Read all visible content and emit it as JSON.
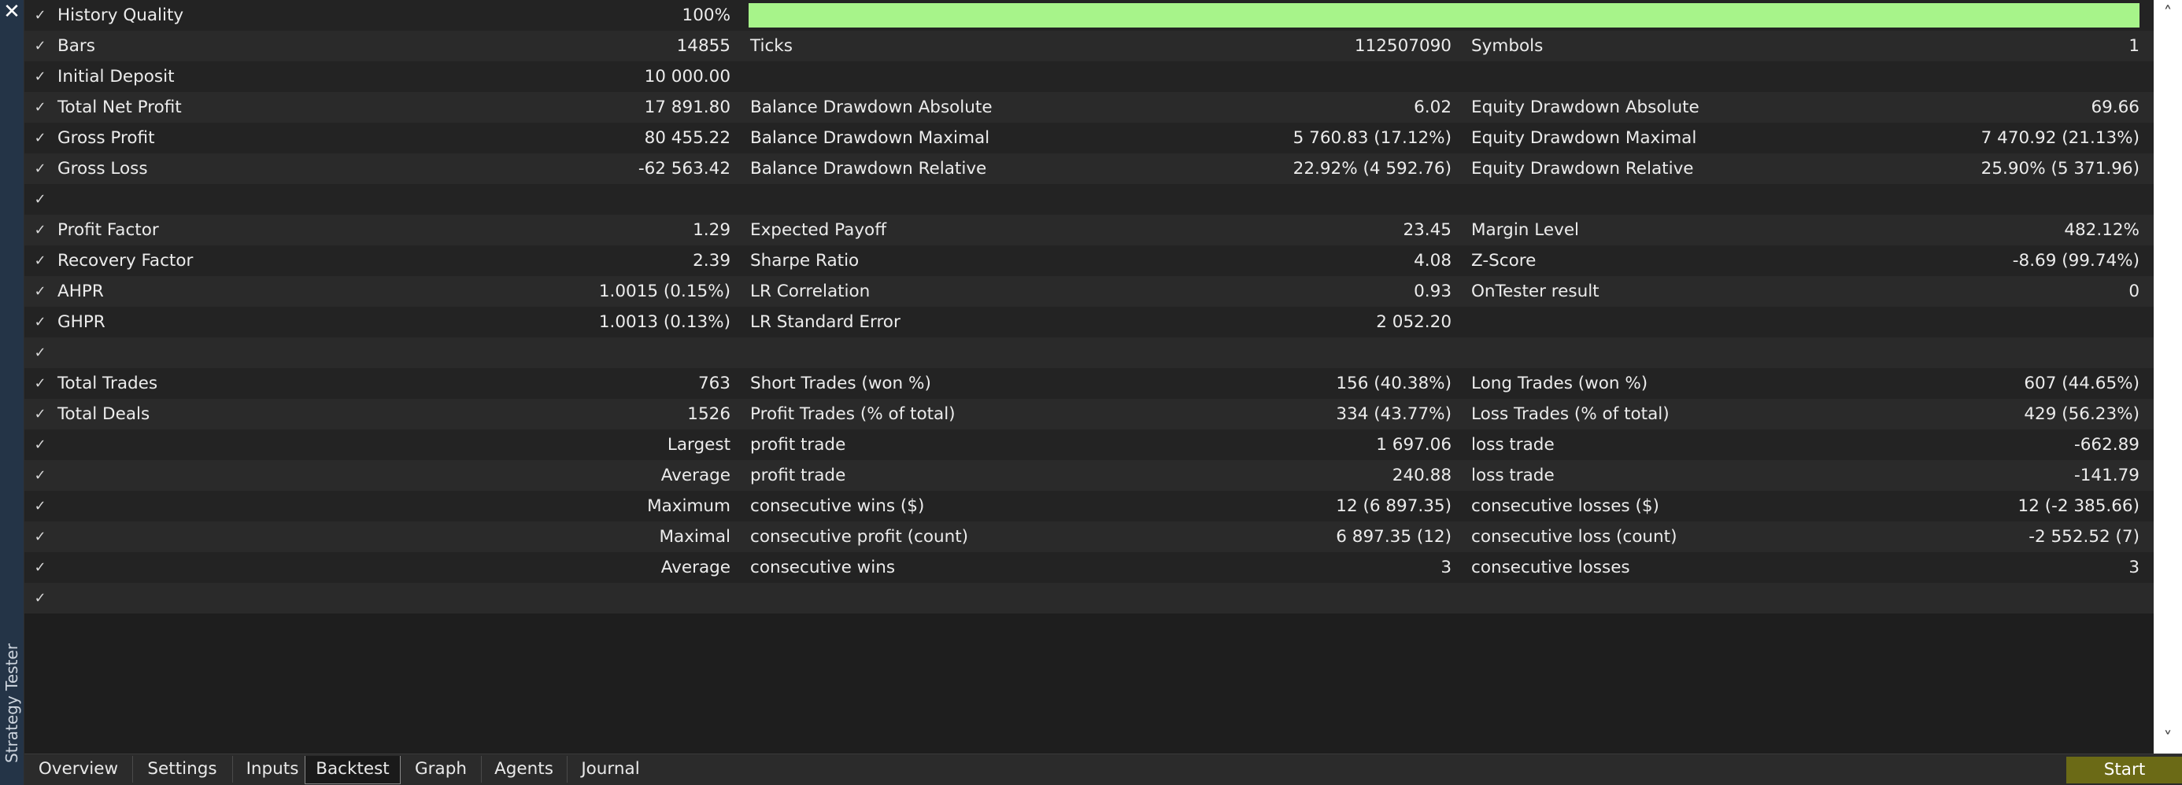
{
  "window": {
    "close_glyph": "✕",
    "title": "Strategy Tester"
  },
  "quality": {
    "label": "History Quality",
    "value": "100%",
    "fraction": 1.0,
    "bar_color": "#a7f48a"
  },
  "rows": [
    {
      "l1": "Bars",
      "v1": "14855",
      "l2": "Ticks",
      "v2": "112507090",
      "l3": "Symbols",
      "v3": "1"
    },
    {
      "l1": "Initial Deposit",
      "v1": "10 000.00",
      "l2": "",
      "v2": "",
      "l3": "",
      "v3": ""
    },
    {
      "l1": "Total Net Profit",
      "v1": "17 891.80",
      "l2": "Balance Drawdown Absolute",
      "v2": "6.02",
      "l3": "Equity Drawdown Absolute",
      "v3": "69.66"
    },
    {
      "l1": "Gross Profit",
      "v1": "80 455.22",
      "l2": "Balance Drawdown Maximal",
      "v2": "5 760.83 (17.12%)",
      "l3": "Equity Drawdown Maximal",
      "v3": "7 470.92 (21.13%)"
    },
    {
      "l1": "Gross Loss",
      "v1": "-62 563.42",
      "l2": "Balance Drawdown Relative",
      "v2": "22.92% (4 592.76)",
      "l3": "Equity Drawdown Relative",
      "v3": "25.90% (5 371.96)"
    },
    {
      "l1": "",
      "v1": "",
      "l2": "",
      "v2": "",
      "l3": "",
      "v3": ""
    },
    {
      "l1": "Profit Factor",
      "v1": "1.29",
      "l2": "Expected Payoff",
      "v2": "23.45",
      "l3": "Margin Level",
      "v3": "482.12%"
    },
    {
      "l1": "Recovery Factor",
      "v1": "2.39",
      "l2": "Sharpe Ratio",
      "v2": "4.08",
      "l3": "Z-Score",
      "v3": "-8.69 (99.74%)"
    },
    {
      "l1": "AHPR",
      "v1": "1.0015 (0.15%)",
      "l2": "LR Correlation",
      "v2": "0.93",
      "l3": "OnTester result",
      "v3": "0"
    },
    {
      "l1": "GHPR",
      "v1": "1.0013 (0.13%)",
      "l2": "LR Standard Error",
      "v2": "2 052.20",
      "l3": "",
      "v3": ""
    },
    {
      "l1": "",
      "v1": "",
      "l2": "",
      "v2": "",
      "l3": "",
      "v3": ""
    },
    {
      "l1": "Total Trades",
      "v1": "763",
      "l2": "Short Trades (won %)",
      "v2": "156 (40.38%)",
      "l3": "Long Trades (won %)",
      "v3": "607 (44.65%)"
    },
    {
      "l1": "Total Deals",
      "v1": "1526",
      "l2": "Profit Trades (% of total)",
      "v2": "334 (43.77%)",
      "l3": "Loss Trades (% of total)",
      "v3": "429 (56.23%)"
    }
  ],
  "right_rows": [
    {
      "l1": "Largest",
      "l2": "profit trade",
      "v2": "1 697.06",
      "l3": "loss trade",
      "v3": "-662.89"
    },
    {
      "l1": "Average",
      "l2": "profit trade",
      "v2": "240.88",
      "l3": "loss trade",
      "v3": "-141.79"
    },
    {
      "l1": "Maximum",
      "l2": "consecutive wins ($)",
      "v2": "12 (6 897.35)",
      "l3": "consecutive losses ($)",
      "v3": "12 (-2 385.66)"
    },
    {
      "l1": "Maximal",
      "l2": "consecutive profit (count)",
      "v2": "6 897.35 (12)",
      "l3": "consecutive loss (count)",
      "v3": "-2 552.52 (7)"
    },
    {
      "l1": "Average",
      "l2": "consecutive wins",
      "v2": "3",
      "l3": "consecutive losses",
      "v3": "3"
    }
  ],
  "check_glyph": "✓",
  "scroll": {
    "up_glyph": "˄",
    "down_glyph": "˅"
  },
  "tabs": [
    {
      "label": "Overview",
      "active": false
    },
    {
      "label": "Settings",
      "active": false
    },
    {
      "label": "Inputs",
      "active": false
    },
    {
      "label": "Backtest",
      "active": true
    },
    {
      "label": "Graph",
      "active": false
    },
    {
      "label": "Agents",
      "active": false
    },
    {
      "label": "Journal",
      "active": false
    }
  ],
  "start_button": {
    "label": "Start",
    "color": "#6b6a16"
  }
}
